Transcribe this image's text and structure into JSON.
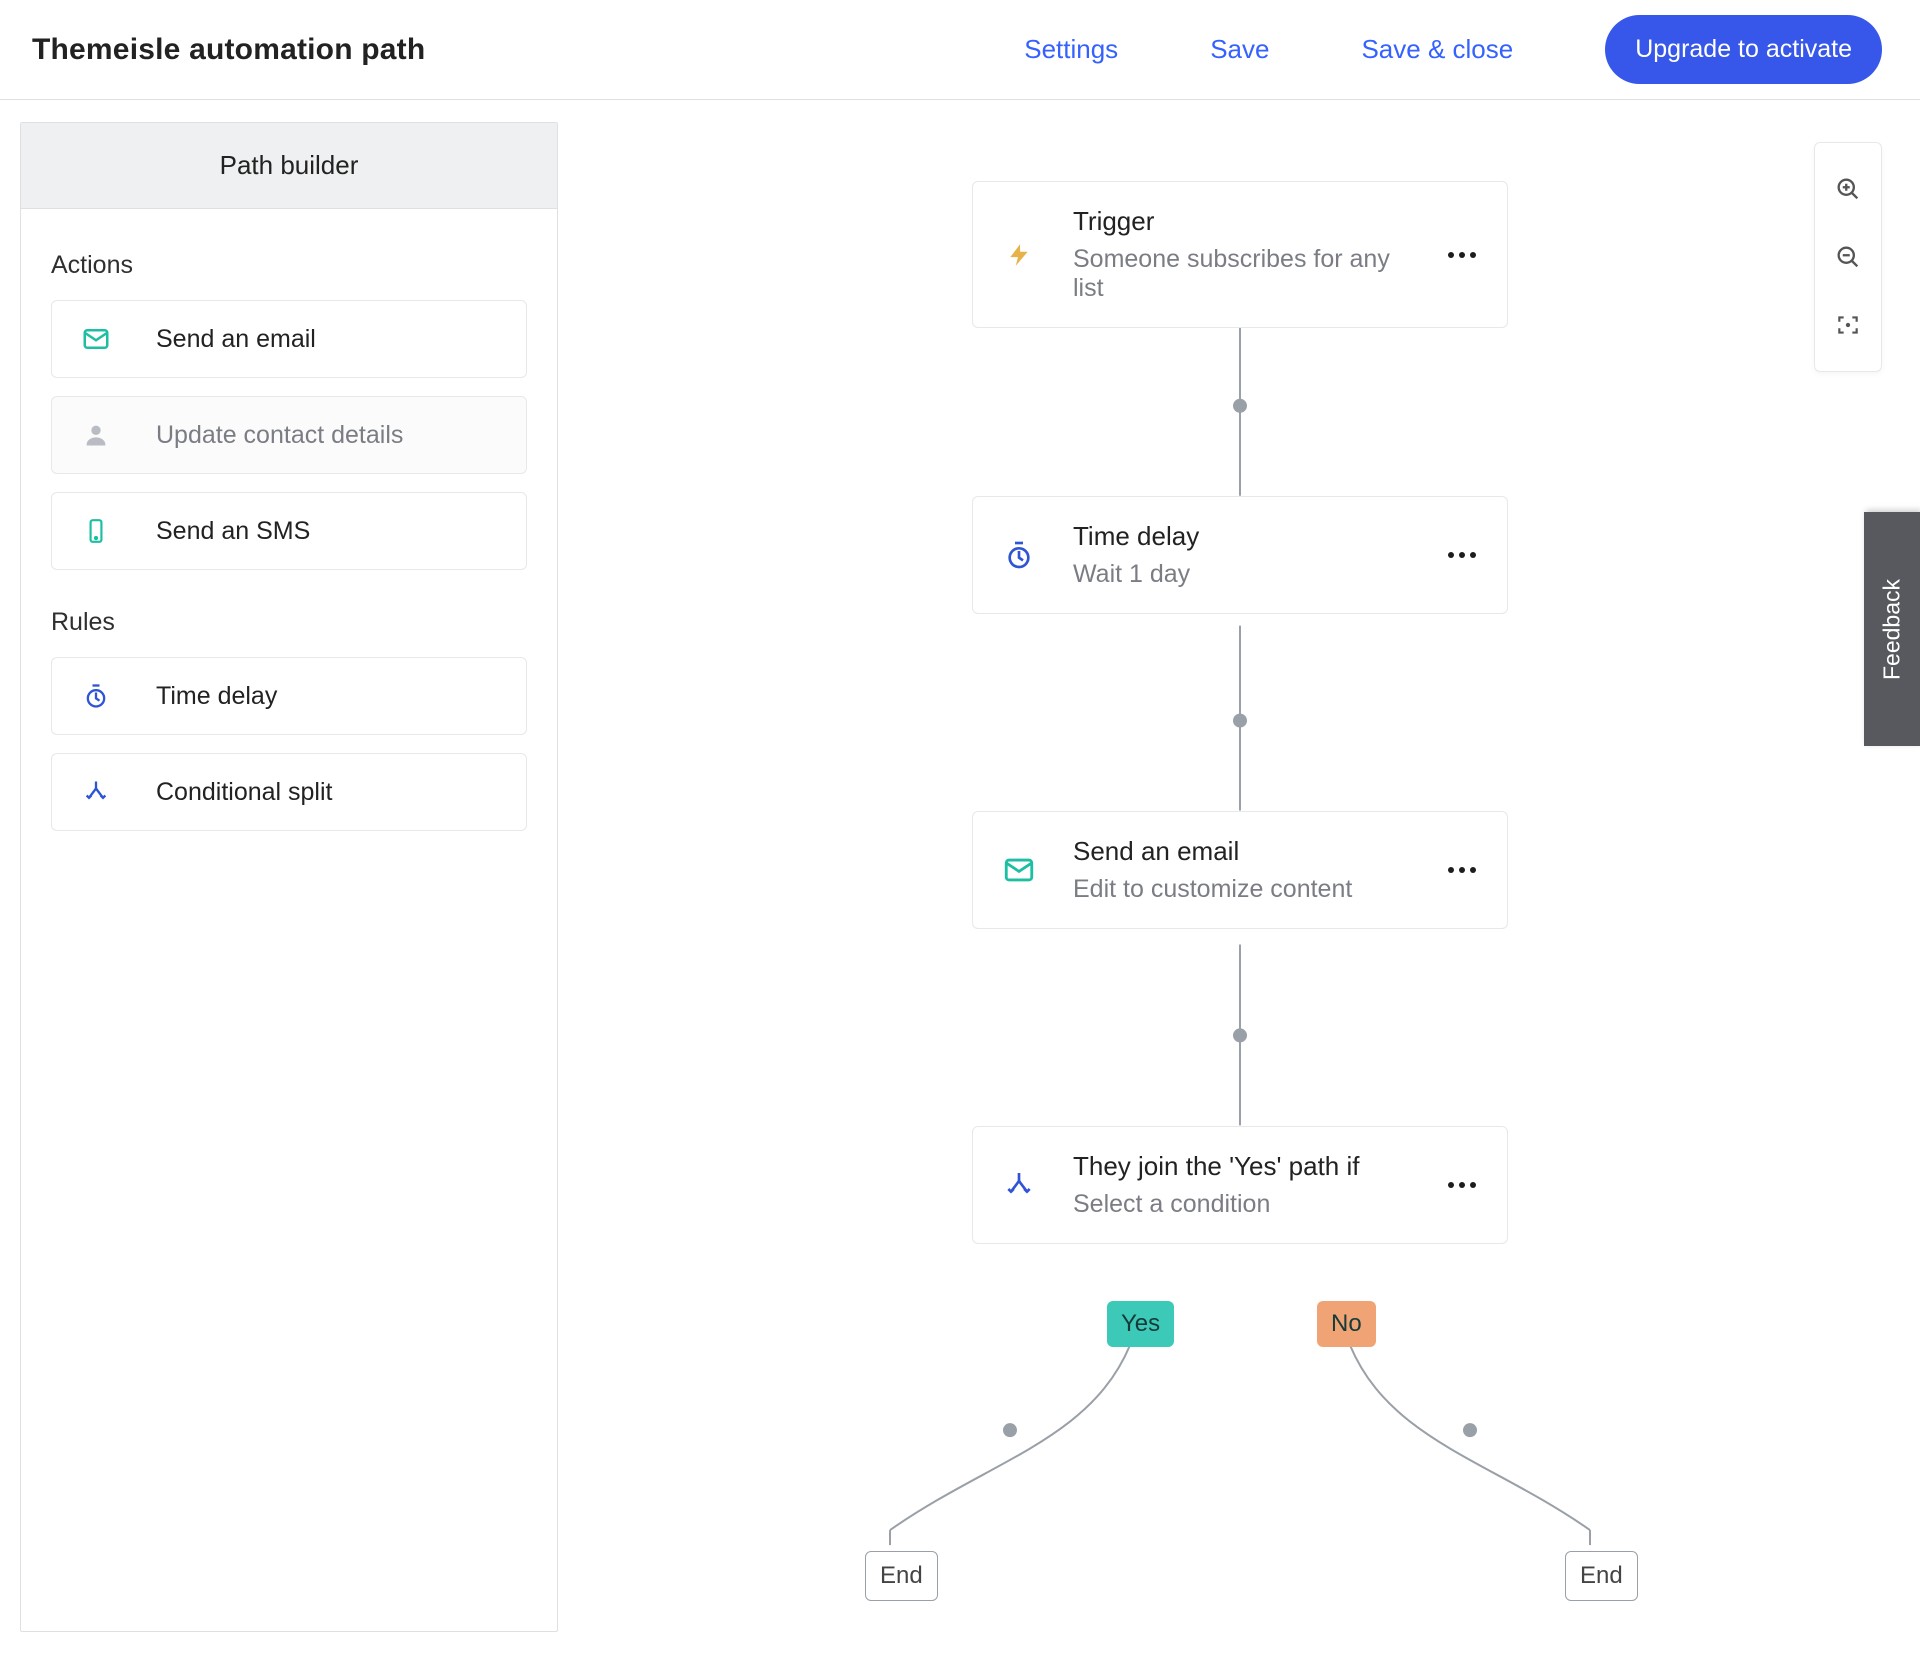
{
  "header": {
    "title": "Themeisle automation path",
    "links": {
      "settings": "Settings",
      "save": "Save",
      "save_close": "Save & close"
    },
    "cta": "Upgrade to activate"
  },
  "sidebar": {
    "title": "Path builder",
    "sections": [
      {
        "title": "Actions",
        "items": [
          {
            "icon": "mail",
            "label": "Send an email",
            "enabled": true
          },
          {
            "icon": "person",
            "label": "Update contact details",
            "enabled": false
          },
          {
            "icon": "phone",
            "label": "Send an SMS",
            "enabled": true
          }
        ]
      },
      {
        "title": "Rules",
        "items": [
          {
            "icon": "timer",
            "label": "Time delay",
            "enabled": true
          },
          {
            "icon": "split",
            "label": "Conditional split",
            "enabled": true
          }
        ]
      }
    ]
  },
  "flow": {
    "nodes": [
      {
        "id": "trigger",
        "icon": "bolt",
        "title": "Trigger",
        "sub": "Someone subscribes for any list"
      },
      {
        "id": "delay",
        "icon": "timer",
        "title": "Time delay",
        "sub": "Wait 1 day"
      },
      {
        "id": "email",
        "icon": "mail",
        "title": "Send an email",
        "sub": "Edit to customize content"
      },
      {
        "id": "cond",
        "icon": "split",
        "title": "They join the 'Yes' path if",
        "sub": "Select a condition"
      }
    ],
    "branches": {
      "yes": "Yes",
      "no": "No",
      "end": "End"
    }
  },
  "feedback_label": "Feedback",
  "icons": {
    "mail": "mail-icon",
    "person": "person-icon",
    "phone": "phone-icon",
    "timer": "timer-icon",
    "split": "split-icon",
    "bolt": "bolt-icon",
    "zoom_in": "zoom-in-icon",
    "zoom_out": "zoom-out-icon",
    "frame": "frame-icon",
    "more": "more-icon"
  },
  "colors": {
    "accent": "#3562ff",
    "teal": "#1dbfa3",
    "yes": "#3cc9b7",
    "no": "#f0a476",
    "grey": "#9aa0a7"
  }
}
